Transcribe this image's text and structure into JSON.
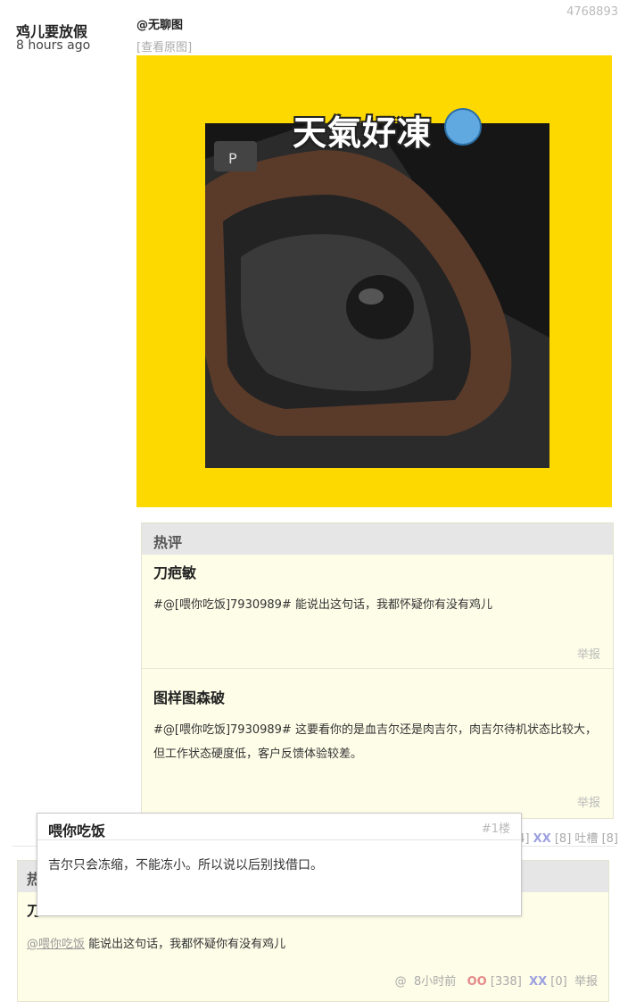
{
  "post": {
    "author": "鸡儿要放假",
    "time": "8 hours ago",
    "id": "4768893",
    "tag": "@无聊图",
    "view_original": "[查看原图]",
    "image_caption": "天氣好凍"
  },
  "hot_comments": {
    "header": "热评",
    "items": [
      {
        "name": "刀疤敏",
        "text": "#@[喂你吃饭]7930989# 能说出这句话，我都怀疑你有没有鸡儿",
        "report": "举报"
      },
      {
        "name": "图样图森破",
        "text": "#@[喂你吃饭]7930989# 这要看你的是血吉尔还是肉吉尔，肉吉尔待机状态比较大，但工作状态硬度低，客户反馈体验较差。",
        "report": "举报"
      }
    ]
  },
  "post_votes": {
    "oo_tail": "4]",
    "xx_label": "XX",
    "xx_count": "[8]",
    "tucao_label": "吐槽",
    "tucao_count": "[8]"
  },
  "comment2": {
    "header": "热",
    "name_partial": "刀",
    "mention": "@喂你吃饭",
    "text": " 能说出这句话，我都怀疑你有没有鸡儿",
    "at": "@",
    "time": "8小时前",
    "oo_label": "OO",
    "oo_count": "[338]",
    "xx_label": "XX",
    "xx_count": "[0]",
    "report": "举报"
  },
  "popup": {
    "name": "喂你吃饭",
    "floor": "#1楼",
    "text": "吉尔只会冻缩，不能冻小。所以说以后别找借口。"
  }
}
